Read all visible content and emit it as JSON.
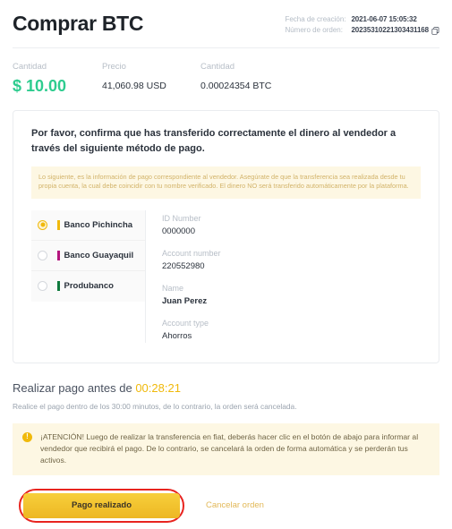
{
  "header": {
    "title": "Comprar BTC",
    "meta": [
      {
        "label": "Fecha de creación:",
        "value": "2021-06-07 15:05:32"
      },
      {
        "label": "Número de orden:",
        "value": "20235310221303431168"
      }
    ],
    "copy_icon": "copy-icon"
  },
  "amounts": [
    {
      "label": "Cantidad",
      "value": "$ 10.00"
    },
    {
      "label": "Precio",
      "value": "41,060.98 USD"
    },
    {
      "label": "Cantidad",
      "value": "0.00024354 BTC"
    }
  ],
  "card": {
    "confirm_text": "Por favor, confirma que has transferido correctamente el dinero al vendedor a través del siguiente método de pago.",
    "notice": "Lo siguiente, es la información de pago correspondiente al vendedor. Asegúrate de que la transferencia sea realizada desde tu propia cuenta, la cual debe coincidir con tu nombre verificado. El dinero NO será transferido automáticamente por la plataforma.",
    "banks": [
      {
        "name": "Banco Pichincha",
        "color": "#f0b90b",
        "selected": true
      },
      {
        "name": "Banco Guayaquil",
        "color": "#b4147d",
        "selected": false
      },
      {
        "name": "Produbanco",
        "color": "#0f7a3d",
        "selected": false
      }
    ],
    "details": [
      {
        "label": "ID Number",
        "value": "0000000",
        "bold": false
      },
      {
        "label": "Account number",
        "value": "220552980",
        "bold": false
      },
      {
        "label": "Name",
        "value": "Juan Perez",
        "bold": true
      },
      {
        "label": "Account type",
        "value": "Ahorros",
        "bold": false
      }
    ]
  },
  "timer": {
    "prefix": "Realizar pago antes de",
    "value": "00:28:21",
    "subtext": "Realice el pago dentro de los 30:00 minutos, de lo contrario, la orden será cancelada."
  },
  "attention": {
    "icon": "warning-icon",
    "text": "¡ATENCIÓN! Luego de realizar la transferencia en fiat, deberás hacer clic en el botón de abajo para informar al vendedor que recibirá el pago. De lo contrario, se cancelará la orden de forma automática y se perderán tus activos."
  },
  "actions": {
    "primary_label": "Pago realizado",
    "cancel_label": "Cancelar orden",
    "highlight_color": "#e8241f"
  },
  "colors": {
    "accent_yellow": "#f0b90b",
    "green": "#2ecc8f",
    "notice_bg": "#fdf7e3"
  }
}
